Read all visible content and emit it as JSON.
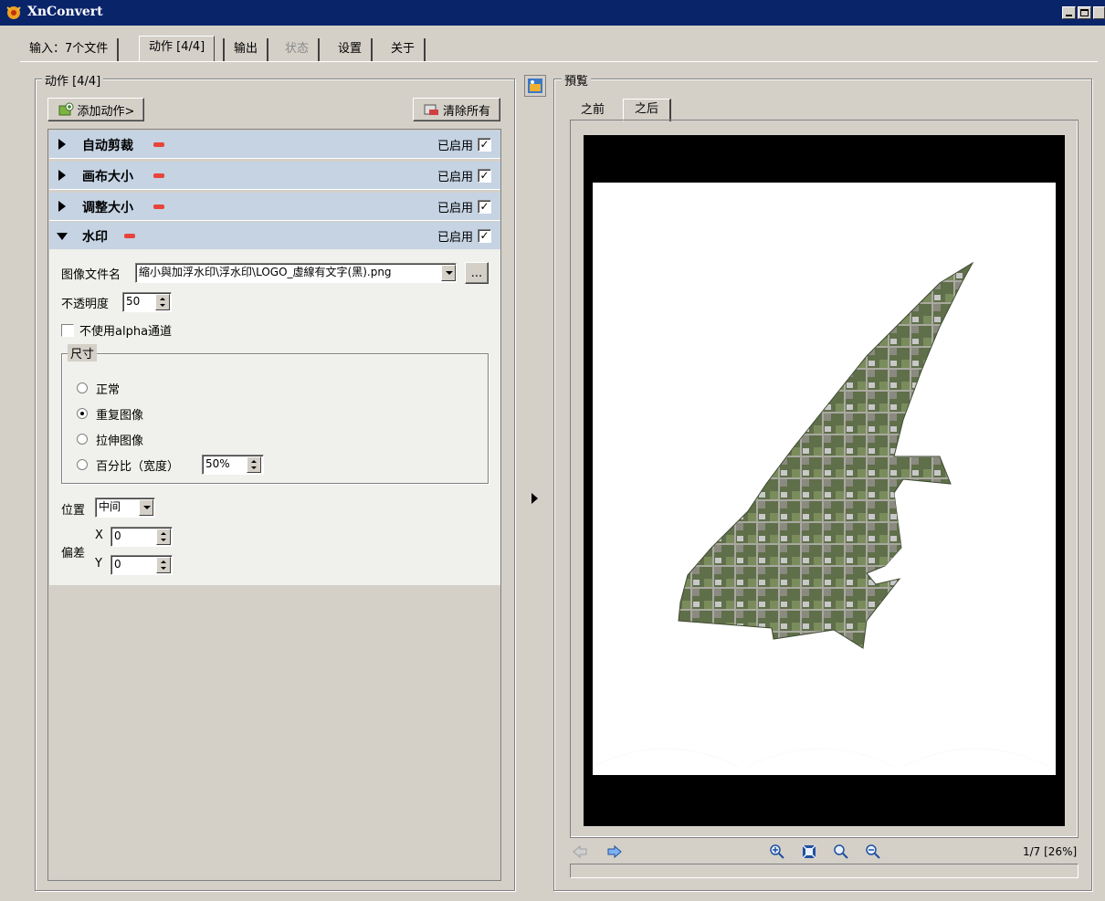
{
  "window": {
    "title": "XnConvert"
  },
  "tabs": [
    {
      "label": "输入：7个文件"
    },
    {
      "label": "动作 [4/4]"
    },
    {
      "label": "输出"
    },
    {
      "label": "状态"
    },
    {
      "label": "设置"
    },
    {
      "label": "关于"
    }
  ],
  "actions_panel": {
    "group_title": "动作 [4/4]",
    "add_button": "添加动作>",
    "clear_button": "清除所有",
    "items": [
      {
        "name": "自动剪裁",
        "enabled_label": "已启用",
        "enabled": true
      },
      {
        "name": "画布大小",
        "enabled_label": "已启用",
        "enabled": true
      },
      {
        "name": "调整大小",
        "enabled_label": "已启用",
        "enabled": true
      },
      {
        "name": "水印",
        "enabled_label": "已启用",
        "enabled": true
      }
    ],
    "watermark": {
      "image_file_label": "图像文件名",
      "image_file_value": "縮小與加浮水印\\浮水印\\LOGO_虛線有文字(黑).png",
      "browse_label": "...",
      "opacity_label": "不透明度",
      "opacity_value": "50",
      "no_alpha_label": "不使用alpha通道",
      "no_alpha_checked": false,
      "size_group_title": "尺寸",
      "size_options": [
        {
          "label": "正常",
          "selected": false
        },
        {
          "label": "重复图像",
          "selected": true
        },
        {
          "label": "拉伸图像",
          "selected": false
        },
        {
          "label": "百分比（宽度）",
          "selected": false
        }
      ],
      "percent_value": "50%",
      "position_label": "位置",
      "position_value": "中间",
      "offset_label": "偏差",
      "x_label": "X",
      "x_value": "0",
      "y_label": "Y",
      "y_value": "0"
    }
  },
  "preview": {
    "group_title": "預覧",
    "tabs": [
      {
        "label": "之前"
      },
      {
        "label": "之后"
      }
    ],
    "page_indicator": "1/7 [26%]"
  },
  "colors": {
    "titlebar": "#0a246a",
    "row_bg": "#c5d3e3",
    "minus": "#e8443a"
  }
}
